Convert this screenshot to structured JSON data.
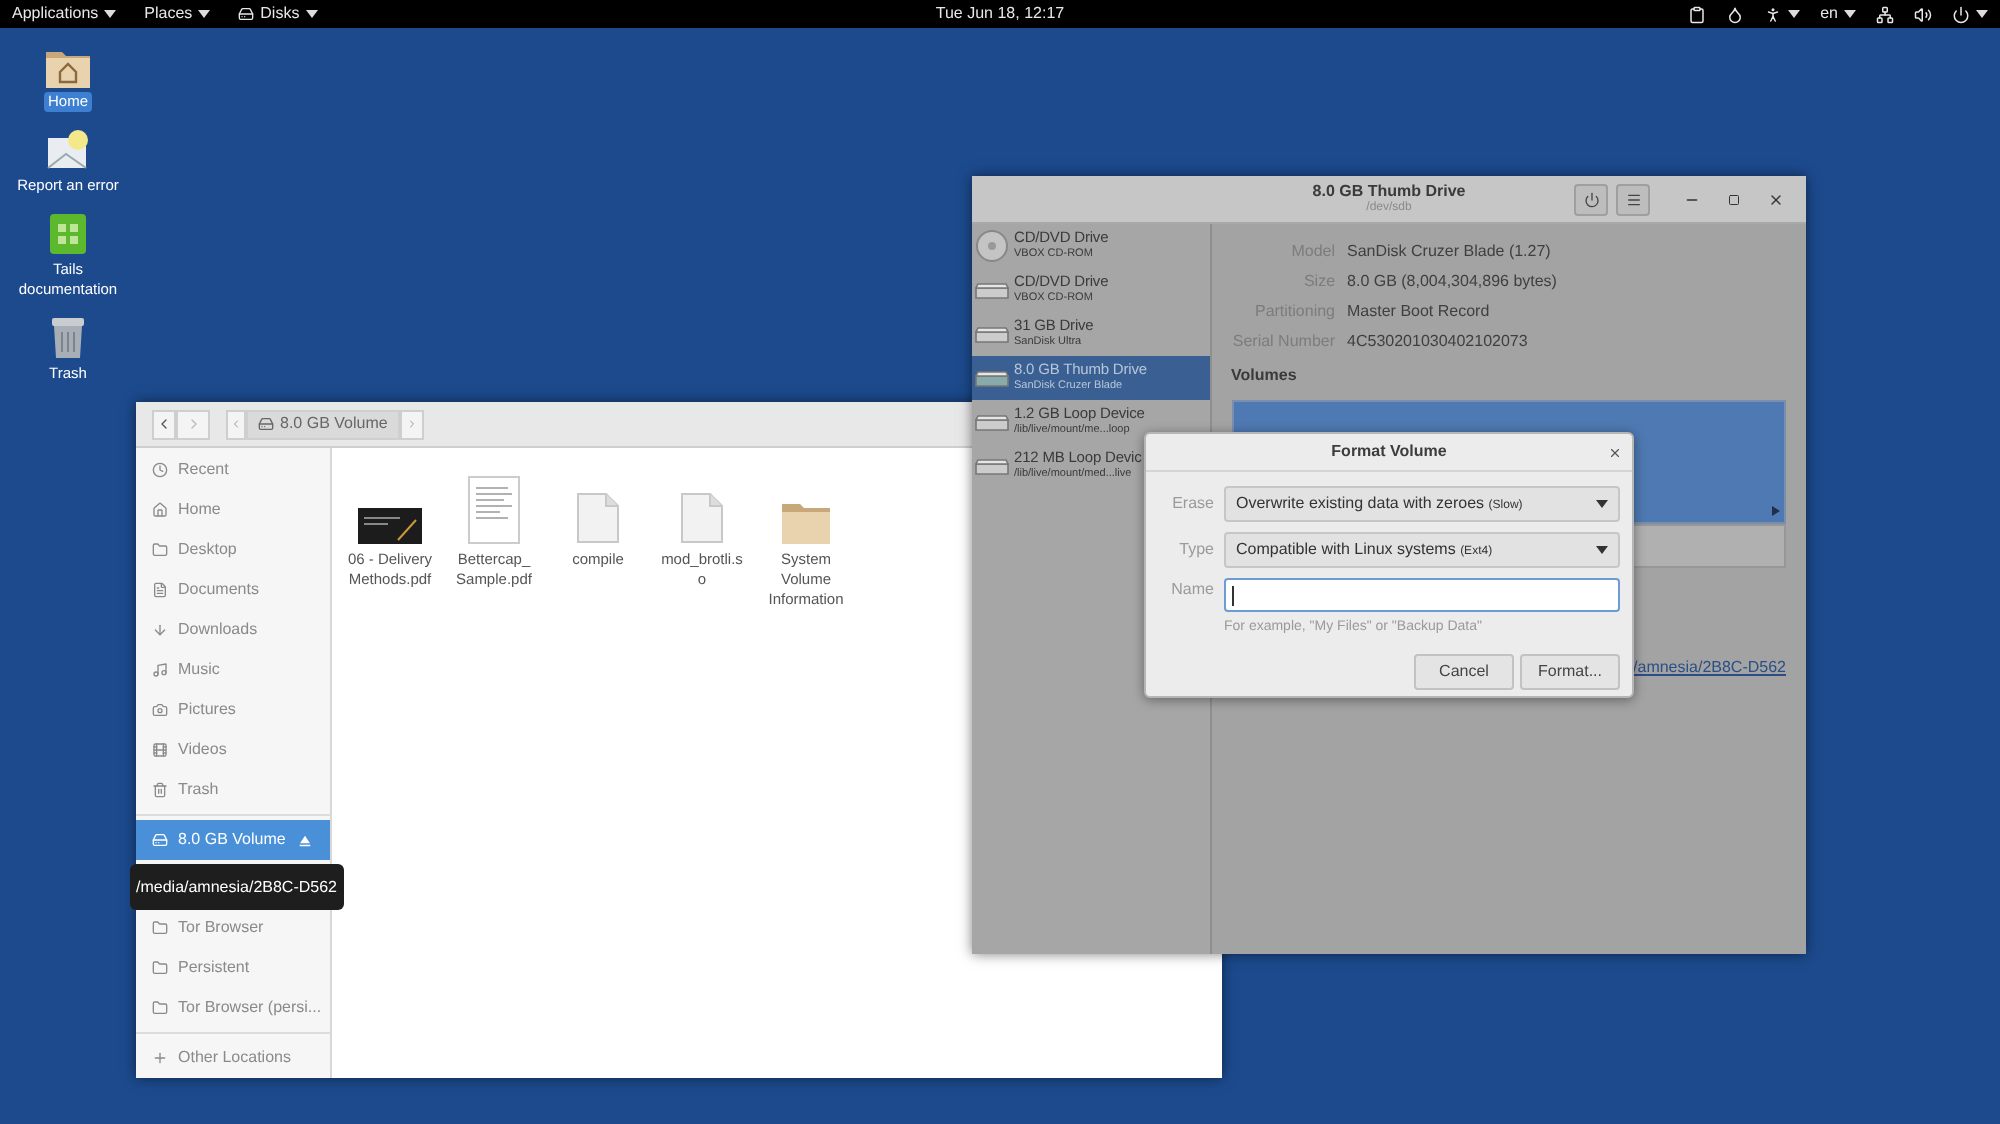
{
  "top_bar": {
    "menus": [
      {
        "label": "Applications",
        "kind": "text"
      },
      {
        "label": "Places",
        "kind": "text"
      },
      {
        "label": "Disks",
        "kind": "app"
      }
    ],
    "clock": "Tue Jun 18, 12:17",
    "language": "en"
  },
  "desktop_icons": [
    {
      "label": "Home",
      "kind": "home",
      "selected": true
    },
    {
      "label": "Report an error",
      "kind": "report",
      "selected": false
    },
    {
      "label": "Tails documentation",
      "kind": "docs",
      "selected": false
    },
    {
      "label": "Trash",
      "kind": "trash",
      "selected": false
    }
  ],
  "files_window": {
    "path_button": "8.0 GB Volume",
    "places": [
      {
        "label": "Recent",
        "kind": "recent",
        "selected": false
      },
      {
        "label": "Home",
        "kind": "home",
        "selected": false
      },
      {
        "label": "Desktop",
        "kind": "folder",
        "selected": false
      },
      {
        "label": "Documents",
        "kind": "document",
        "selected": false
      },
      {
        "label": "Downloads",
        "kind": "download",
        "selected": false
      },
      {
        "label": "Music",
        "kind": "music",
        "selected": false
      },
      {
        "label": "Pictures",
        "kind": "camera",
        "selected": false
      },
      {
        "label": "Videos",
        "kind": "video",
        "selected": false
      },
      {
        "label": "Trash",
        "kind": "trash",
        "selected": false
      }
    ],
    "devices": [
      {
        "label": "8.0 GB Volume",
        "kind": "drive",
        "selected": true,
        "ejectable": true
      }
    ],
    "bookmarks": [
      {
        "label": "Tor Browser",
        "kind": "folder",
        "selected": false
      },
      {
        "label": "Persistent",
        "kind": "folder",
        "selected": false
      },
      {
        "label": "Tor Browser (persi...",
        "kind": "folder",
        "selected": false
      }
    ],
    "other_locations": "Other Locations",
    "files": [
      {
        "name": "06 - Delivery Methods.pdf",
        "kind": "dark-pdf"
      },
      {
        "name": "Bettercap_ Sample.pdf",
        "kind": "pdf"
      },
      {
        "name": "compile",
        "kind": "text"
      },
      {
        "name": "mod_brotli.so",
        "kind": "text"
      },
      {
        "name": "System Volume Information",
        "kind": "folder"
      }
    ]
  },
  "tooltip": "/media/amnesia/2B8C-D562",
  "disks_window": {
    "title": "8.0 GB Thumb Drive",
    "subtitle": "/dev/sdb",
    "drives": [
      {
        "name": "CD/DVD Drive",
        "detail": "VBOX CD-ROM",
        "kind": "optical",
        "selected": false
      },
      {
        "name": "CD/DVD Drive",
        "detail": "VBOX CD-ROM",
        "kind": "drive",
        "selected": false
      },
      {
        "name": "31 GB Drive",
        "detail": "SanDisk Ultra",
        "kind": "drive",
        "selected": false
      },
      {
        "name": "8.0 GB Thumb Drive",
        "detail": "SanDisk Cruzer Blade",
        "kind": "drive",
        "selected": true
      },
      {
        "name": "1.2 GB Loop Device",
        "detail": "/lib/live/mount/me...loop",
        "kind": "drive",
        "selected": false
      },
      {
        "name": "212 MB Loop Devic",
        "detail": "/lib/live/mount/med...live",
        "kind": "drive",
        "selected": false
      }
    ],
    "details": [
      {
        "label": "Model",
        "value": "SanDisk Cruzer Blade (1.27)"
      },
      {
        "label": "Size",
        "value": "8.0 GB (8,004,304,896 bytes)"
      },
      {
        "label": "Partitioning",
        "value": "Master Boot Record"
      },
      {
        "label": "Serial Number",
        "value": "4C530201030402102073"
      }
    ],
    "volumes_heading": "Volumes",
    "mount_link": "/amnesia/2B8C-D562"
  },
  "format_dialog": {
    "title": "Format Volume",
    "fields": [
      {
        "label": "Erase",
        "kind": "dropdown",
        "value": "Overwrite existing data with zeroes",
        "note": "(Slow)"
      },
      {
        "label": "Type",
        "kind": "dropdown",
        "value": "Compatible with Linux systems",
        "note": "(Ext4)"
      },
      {
        "label": "Name",
        "kind": "text",
        "focused": true,
        "hint": "For example, \"My Files\" or \"Backup Data\""
      }
    ],
    "buttons": [
      "Cancel",
      "Format..."
    ]
  }
}
